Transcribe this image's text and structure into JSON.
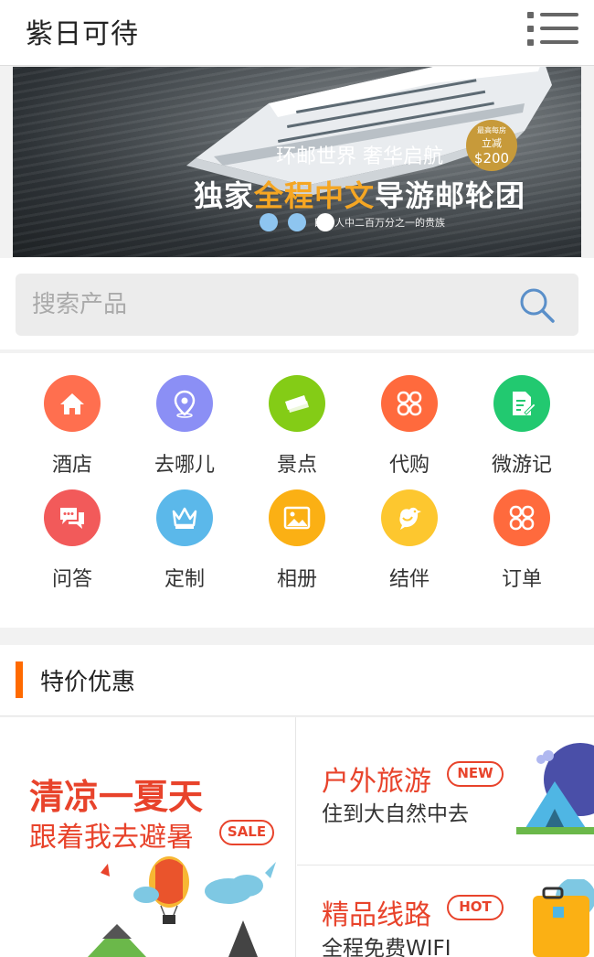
{
  "header": {
    "title": "紫日可待"
  },
  "banner": {
    "subtitle": "环邮世界 奢华启航",
    "main_prefix": "独家",
    "main_highlight": "全程中文",
    "main_suffix": "导游邮轮团",
    "badge_top": "最高每房",
    "badge_mid": "立减",
    "badge_amount": "$200",
    "small_text": "四亿人中二百万分之一的贵族",
    "dots_active_index": 2
  },
  "search": {
    "placeholder": "搜索产品"
  },
  "grid": {
    "items": [
      {
        "label": "酒店",
        "icon": "home-icon",
        "color": "#ff6f4f"
      },
      {
        "label": "去哪儿",
        "icon": "location-pin-icon",
        "color": "#8b8ff5"
      },
      {
        "label": "景点",
        "icon": "ticket-icon",
        "color": "#84cc16"
      },
      {
        "label": "代购",
        "icon": "clover-icon",
        "color": "#ff6a3d"
      },
      {
        "label": "微游记",
        "icon": "note-edit-icon",
        "color": "#22c970"
      },
      {
        "label": "问答",
        "icon": "chat-bubble-icon",
        "color": "#f25a5a"
      },
      {
        "label": "定制",
        "icon": "crown-icon",
        "color": "#5bb8ea"
      },
      {
        "label": "相册",
        "icon": "image-icon",
        "color": "#fbb014"
      },
      {
        "label": "结伴",
        "icon": "bird-icon",
        "color": "#fdc72f"
      },
      {
        "label": "订单",
        "icon": "clover-icon",
        "color": "#ff6a3d"
      }
    ]
  },
  "section": {
    "title": "特价优惠",
    "accent": "#ff6a00"
  },
  "promos": {
    "left": {
      "title": "清凉一夏天",
      "subtitle": "跟着我去避暑",
      "tag": "SALE"
    },
    "right_top": {
      "title": "户外旅游",
      "subtitle": "住到大自然中去",
      "tag": "NEW"
    },
    "right_bottom": {
      "title": "精品线路",
      "subtitle": "全程免费WIFI",
      "tag": "HOT"
    }
  }
}
